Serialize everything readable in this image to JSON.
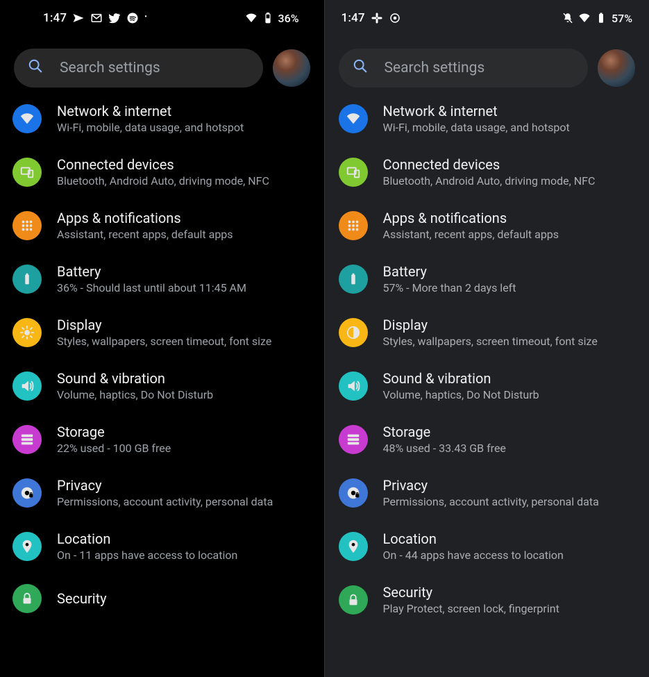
{
  "left": {
    "statusbar": {
      "time": "1:47",
      "battery_text": "36%"
    },
    "search_placeholder": "Search settings",
    "items": [
      {
        "id": "network",
        "title": "Network & internet",
        "sub": "Wi-Fi, mobile, data usage, and hotspot"
      },
      {
        "id": "devices",
        "title": "Connected devices",
        "sub": "Bluetooth, Android Auto, driving mode, NFC"
      },
      {
        "id": "apps",
        "title": "Apps & notifications",
        "sub": "Assistant, recent apps, default apps"
      },
      {
        "id": "battery",
        "title": "Battery",
        "sub": "36% - Should last until about 11:45 AM"
      },
      {
        "id": "display",
        "title": "Display",
        "sub": "Styles, wallpapers, screen timeout, font size"
      },
      {
        "id": "sound",
        "title": "Sound & vibration",
        "sub": "Volume, haptics, Do Not Disturb"
      },
      {
        "id": "storage",
        "title": "Storage",
        "sub": "22% used - 100 GB free"
      },
      {
        "id": "privacy",
        "title": "Privacy",
        "sub": "Permissions, account activity, personal data"
      },
      {
        "id": "location",
        "title": "Location",
        "sub": "On - 11 apps have access to location"
      },
      {
        "id": "security",
        "title": "Security",
        "sub": ""
      }
    ]
  },
  "right": {
    "statusbar": {
      "time": "1:47",
      "battery_text": "57%"
    },
    "search_placeholder": "Search settings",
    "items": [
      {
        "id": "network",
        "title": "Network & internet",
        "sub": "Wi-Fi, mobile, data usage, and hotspot"
      },
      {
        "id": "devices",
        "title": "Connected devices",
        "sub": "Bluetooth, Android Auto, driving mode, NFC"
      },
      {
        "id": "apps",
        "title": "Apps & notifications",
        "sub": "Assistant, recent apps, default apps"
      },
      {
        "id": "battery",
        "title": "Battery",
        "sub": "57% - More than 2 days left"
      },
      {
        "id": "display",
        "title": "Display",
        "sub": "Styles, wallpapers, screen timeout, font size"
      },
      {
        "id": "sound",
        "title": "Sound & vibration",
        "sub": "Volume, haptics, Do Not Disturb"
      },
      {
        "id": "storage",
        "title": "Storage",
        "sub": "48% used - 33.43 GB free"
      },
      {
        "id": "privacy",
        "title": "Privacy",
        "sub": "Permissions, account activity, personal data"
      },
      {
        "id": "location",
        "title": "Location",
        "sub": "On - 44 apps have access to location"
      },
      {
        "id": "security",
        "title": "Security",
        "sub": "Play Protect, screen lock, fingerprint"
      }
    ]
  }
}
